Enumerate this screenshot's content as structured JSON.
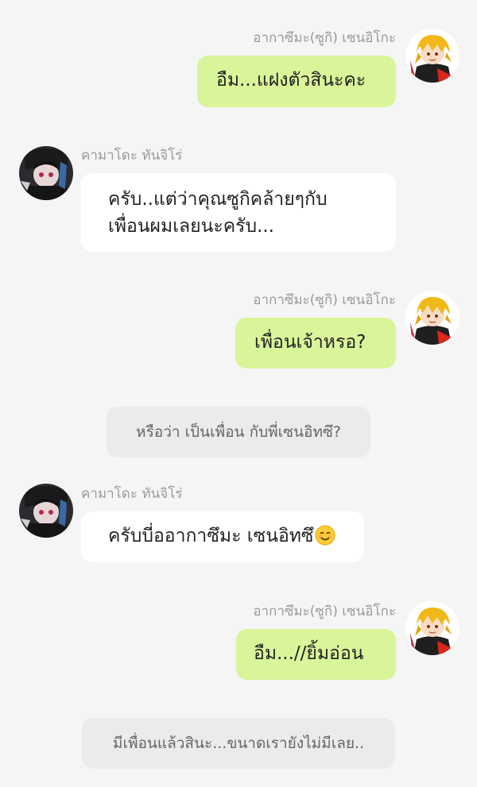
{
  "messages": [
    {
      "sender": "อากาซึมะ(ซูกิ) เซนอิโกะ",
      "text": "อืม...แฝงตัวสินะคะ",
      "side": "right"
    },
    {
      "sender": "คามาโดะ ทันจิโร่",
      "text_lines": [
        "ครับ..แต่ว่าคุณซูกิคล้ายๆกับ",
        "เพื่อนผมเลยนะครับ..."
      ],
      "side": "left"
    },
    {
      "sender": "อากาซึมะ(ซูกิ) เซนอิโกะ",
      "text": "เพื่อนเจ้าหรอ?",
      "side": "right"
    },
    {
      "narration": "หรือว่า เป็นเพื่อน กับพี่เซนอิทซึ?"
    },
    {
      "sender": "คามาโดะ ทันจิโร่",
      "text": "ครับบี่ออากาซึมะ เซนอิทซึ",
      "emoji": "smiling-face-emoji",
      "side": "left"
    },
    {
      "sender": "อากาซึมะ(ซูกิ) เซนอิโกะ",
      "text": "อืม...//ยิ้มอ่อน",
      "side": "right"
    },
    {
      "narration": "มีเพื่อนแล้วสินะ...ขนาดเรายังไม่มีเลย.."
    }
  ],
  "colors": {
    "background": "#f5f5f5",
    "bubble_right": "#d8f59a",
    "bubble_left": "#ffffff",
    "narration_bg": "#ebebeb",
    "sender_name": "#9a9a9a"
  },
  "icons": {
    "zenitsu_avatar": "zenitsu-avatar",
    "tanjiro_avatar": "tanjiro-avatar"
  }
}
